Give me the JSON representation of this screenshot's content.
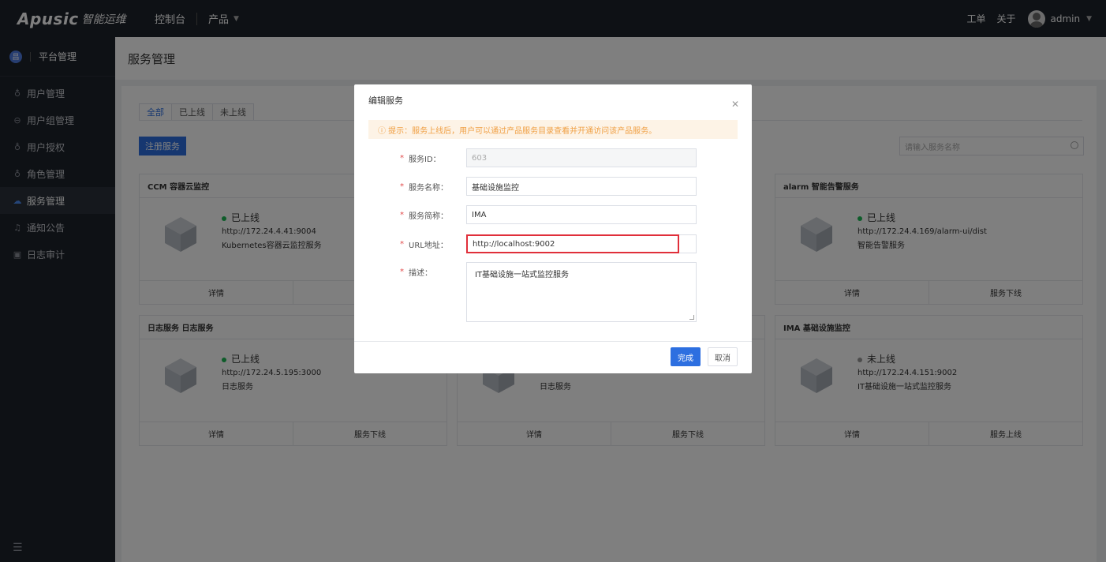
{
  "topbar": {
    "logo_main": "Apusic",
    "logo_sub": "智能运维",
    "nav_console": "控制台",
    "nav_product": "产品",
    "ticket": "工单",
    "about": "关于",
    "user": "admin"
  },
  "sidebar": {
    "head_badge": "昌",
    "head_label": "平台管理",
    "items": [
      {
        "icon": "user-icon",
        "label": "用户管理"
      },
      {
        "icon": "group-icon",
        "label": "用户组管理"
      },
      {
        "icon": "user-icon",
        "label": "用户授权"
      },
      {
        "icon": "user-icon",
        "label": "角色管理"
      },
      {
        "icon": "service-icon",
        "label": "服务管理"
      },
      {
        "icon": "bell-icon",
        "label": "通知公告"
      },
      {
        "icon": "calendar-icon",
        "label": "日志审计"
      }
    ]
  },
  "main": {
    "page_title": "服务管理",
    "tabs": [
      "全部",
      "已上线",
      "未上线"
    ],
    "register_button": "注册服务",
    "search_placeholder": "请输入服务名称",
    "cards": [
      {
        "title": "CCM 容器云监控",
        "status": "已上线",
        "url": "http://172.24.4.41:9004",
        "desc": "Kubernetes容器云监控服务",
        "left": "详情",
        "right": ""
      },
      {
        "title": "alarm 智能告警服务",
        "status": "已上线",
        "url": "http://172.24.4.169/alarm-ui/dist",
        "desc": "智能告警服务",
        "left": "详情",
        "right": "服务下线"
      },
      {
        "title": "日志服务 日志服务",
        "status": "已上线",
        "url": "http://172.24.5.195:3000",
        "desc": "日志服务",
        "left": "详情",
        "right": "服务下线"
      },
      {
        "title": "",
        "status": "",
        "url": "",
        "desc": "日志服务",
        "left": "详情",
        "right": "服务下线"
      },
      {
        "title": "IMA 基础设施监控",
        "status": "未上线",
        "url": "http://172.24.4.151:9002",
        "desc": "IT基础设施一站式监控服务",
        "left": "详情",
        "right": "服务上线"
      }
    ]
  },
  "modal": {
    "title": "编辑服务",
    "tip": "ⓘ 提示：服务上线后，用户可以通过产品服务目录查看并开通访问该产品服务。",
    "fields": {
      "service_id_label": "服务ID：",
      "service_id_value": "603",
      "service_name_label": "服务名称：",
      "service_name_value": "基础设施监控",
      "service_short_label": "服务简称：",
      "service_short_value": "IMA",
      "url_label": "URL地址：",
      "url_value": "http://localhost:9002",
      "desc_label": "描述：",
      "desc_value": "IT基础设施一站式监控服务"
    },
    "done": "完成",
    "cancel": "取消"
  },
  "colors": {
    "primary": "#2d6fe0",
    "sidebar_bg": "#1d222b",
    "online": "#1db954",
    "highlight": "#e02f3a"
  }
}
